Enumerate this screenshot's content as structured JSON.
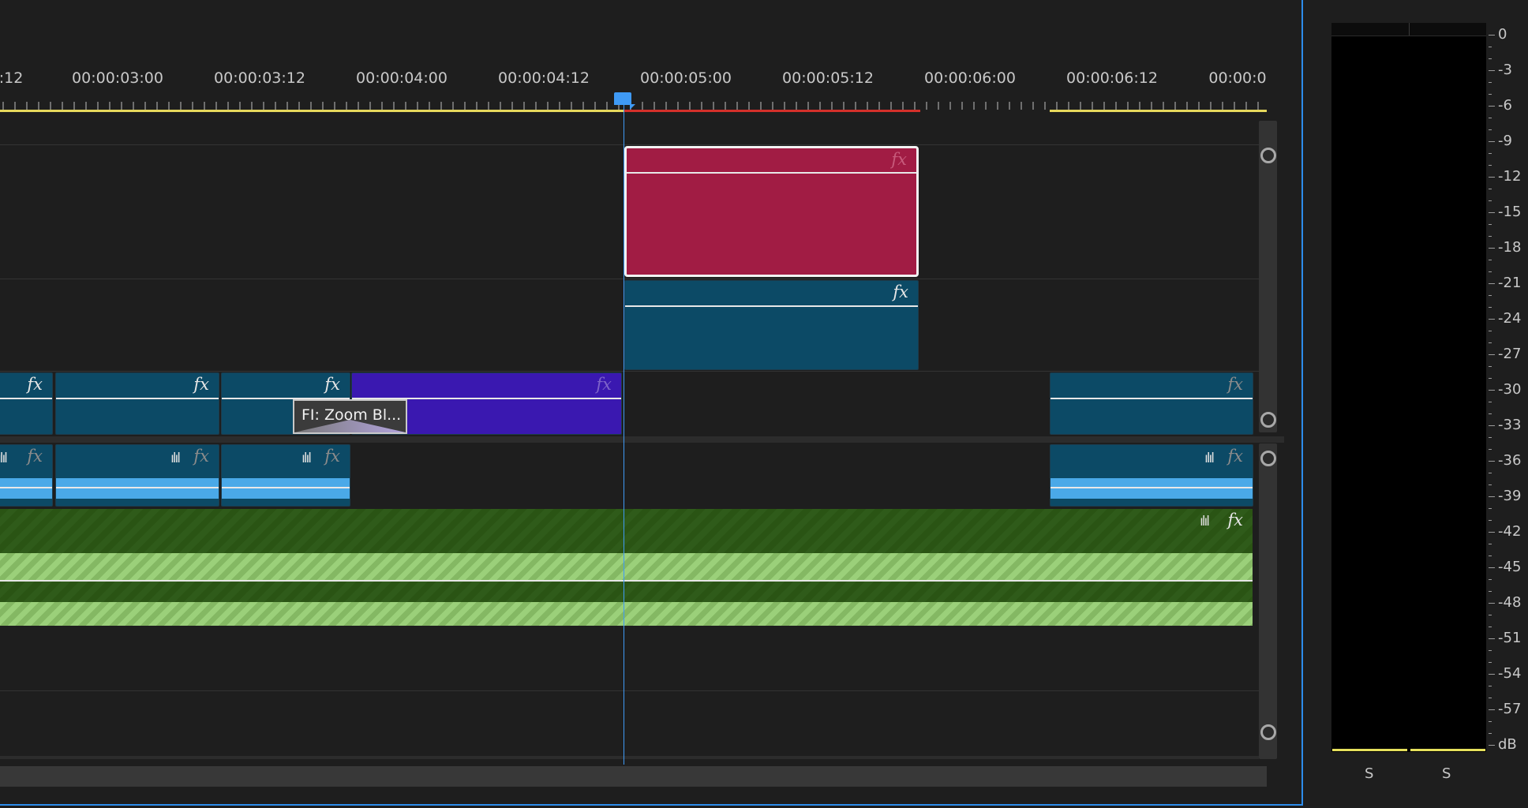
{
  "ruler": {
    "labels": [
      ":12",
      "00:00:03:00",
      "00:00:03:12",
      "00:00:04:00",
      "00:00:04:12",
      "00:00:05:00",
      "00:00:05:12",
      "00:00:06:00",
      "00:00:06:12",
      "00:00:0"
    ]
  },
  "colors": {
    "workarea_yellow": "#e6d85c",
    "render_red": "#d4302a",
    "playhead_blue": "#3f9af5",
    "clip_teal": "#0c4a66",
    "clip_magenta": "#a11c44",
    "clip_purple": "#3a18b0",
    "audio_blue": "#4aa9e8",
    "music_green": "#2a5414"
  },
  "clips": {
    "fx_label": "fx",
    "wave_icon": "ılıl"
  },
  "transition": {
    "label": "FI: Zoom Bl..."
  },
  "meter": {
    "db_labels": [
      "0",
      "-3",
      "-6",
      "-9",
      "-12",
      "-15",
      "-18",
      "-21",
      "-24",
      "-27",
      "-30",
      "-33",
      "-36",
      "-39",
      "-42",
      "-45",
      "-48",
      "-51",
      "-54",
      "-57",
      "dB"
    ],
    "channels": [
      "S",
      "S"
    ]
  }
}
